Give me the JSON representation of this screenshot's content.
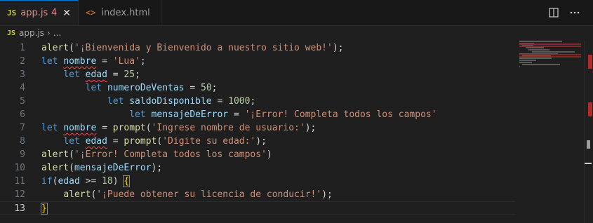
{
  "tabs": [
    {
      "icon": "JS",
      "title": "app.js",
      "badge": "4",
      "close": "✕"
    },
    {
      "icon": "<>",
      "title": "index.html"
    }
  ],
  "breadcrumb": {
    "icon": "JS",
    "file": "app.js",
    "sep": "›",
    "more": "..."
  },
  "editor": {
    "lines": [
      {
        "n": "1",
        "tokens": [
          [
            "fn",
            "alert"
          ],
          [
            "pun",
            "("
          ],
          [
            "str",
            "'¡Bienvenida y Bienvenido a nuestro sitio web!'"
          ],
          [
            "pun",
            ");"
          ]
        ]
      },
      {
        "n": "2",
        "tokens": [
          [
            "kw",
            "let "
          ],
          [
            "var err",
            "nombre"
          ],
          [
            "pun",
            " = "
          ],
          [
            "str",
            "'Lua'"
          ],
          [
            "pun",
            ";"
          ]
        ]
      },
      {
        "n": "3",
        "indent": "    ",
        "tokens": [
          [
            "kw",
            "let "
          ],
          [
            "var err",
            "edad"
          ],
          [
            "pun",
            " = "
          ],
          [
            "num",
            "25"
          ],
          [
            "pun",
            ";"
          ]
        ]
      },
      {
        "n": "4",
        "indent": "        ",
        "tokens": [
          [
            "kw",
            "let "
          ],
          [
            "var",
            "numeroDeVentas"
          ],
          [
            "pun",
            " = "
          ],
          [
            "num",
            "50"
          ],
          [
            "pun",
            ";"
          ]
        ]
      },
      {
        "n": "5",
        "indent": "            ",
        "tokens": [
          [
            "kw",
            "let "
          ],
          [
            "var",
            "saldoDisponible"
          ],
          [
            "pun",
            " = "
          ],
          [
            "num",
            "1000"
          ],
          [
            "pun",
            ";"
          ]
        ]
      },
      {
        "n": "6",
        "indent": "                ",
        "tokens": [
          [
            "kw",
            "let "
          ],
          [
            "var",
            "mensajeDeError"
          ],
          [
            "pun",
            " = "
          ],
          [
            "str",
            "'¡Error! Completa todos los campos'"
          ]
        ]
      },
      {
        "n": "7",
        "tokens": [
          [
            "kw",
            "let "
          ],
          [
            "var err",
            "nombre"
          ],
          [
            "pun",
            " = "
          ],
          [
            "fn",
            "prompt"
          ],
          [
            "pun",
            "("
          ],
          [
            "str",
            "'Ingrese nombre de usuario:'"
          ],
          [
            "pun",
            ");"
          ]
        ]
      },
      {
        "n": "8",
        "indent": "    ",
        "tokens": [
          [
            "kw",
            "let "
          ],
          [
            "var err",
            "edad"
          ],
          [
            "pun",
            " = "
          ],
          [
            "fn",
            "prompt"
          ],
          [
            "pun",
            "("
          ],
          [
            "str",
            "'Digite su edad:'"
          ],
          [
            "pun",
            ");"
          ]
        ]
      },
      {
        "n": "9",
        "tokens": [
          [
            "fn",
            "alert"
          ],
          [
            "pun",
            "("
          ],
          [
            "str",
            "'¡Error! Completa todos los campos'"
          ],
          [
            "pun",
            ")"
          ]
        ]
      },
      {
        "n": "10",
        "tokens": [
          [
            "fn",
            "alert"
          ],
          [
            "pun",
            "("
          ],
          [
            "var",
            "mensajeDeError"
          ],
          [
            "pun",
            ");"
          ]
        ]
      },
      {
        "n": "11",
        "tokens": [
          [
            "kw",
            "if"
          ],
          [
            "pun",
            "("
          ],
          [
            "var",
            "edad"
          ],
          [
            "pun",
            " >= "
          ],
          [
            "num",
            "18"
          ],
          [
            "pun",
            ") "
          ],
          [
            "brace",
            "{"
          ]
        ]
      },
      {
        "n": "12",
        "indent": "    ",
        "tokens": [
          [
            "fn",
            "alert"
          ],
          [
            "pun",
            "("
          ],
          [
            "str",
            "'¡Puede obtener su licencia de conducir!'"
          ],
          [
            "pun",
            ");"
          ]
        ]
      },
      {
        "n": "13",
        "current": true,
        "tokens": [
          [
            "brace",
            "}"
          ]
        ]
      }
    ]
  },
  "colors": {
    "accent": "#0078d4",
    "error": "#f14c4c",
    "keyword": "#569cd6",
    "function": "#dcdcaa",
    "string": "#ce9178",
    "number": "#b5cea8",
    "variable": "#9cdcfe"
  },
  "icons": {
    "split": "split-editor-icon",
    "more": "more-actions-icon"
  }
}
